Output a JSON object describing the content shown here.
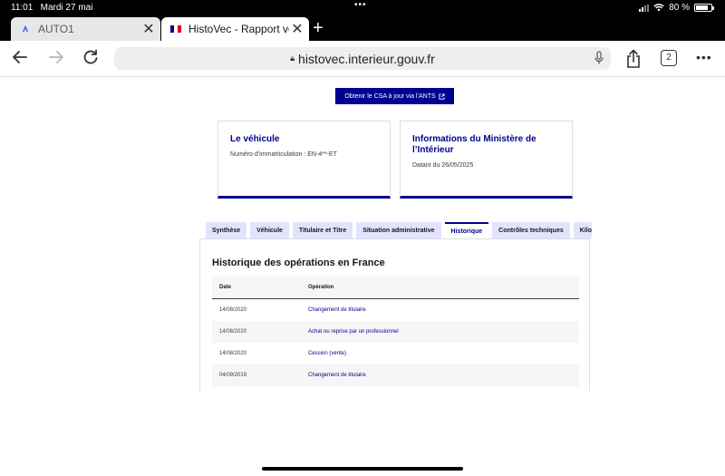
{
  "status": {
    "time": "11:01",
    "date": "Mardi 27 mai",
    "battery": "80 %",
    "battery_level": 0.8
  },
  "browser": {
    "tabs": [
      {
        "title": "AUTO1",
        "favicon": "auto1-logo-icon"
      },
      {
        "title": "HistoVec - Rapport vendeur",
        "favicon": "french-flag-icon"
      }
    ],
    "url": "histovec.interieur.gouv.fr",
    "tab_count": "2"
  },
  "page": {
    "cta_label": "Obtenir le CSA à jour via l’ANTS",
    "cards": [
      {
        "title": "Le véhicule",
        "desc": "Numéro d’immatriculation : EN-4**-ET"
      },
      {
        "title": "Informations du Ministère de l’Intérieur",
        "desc": "Datant du 26/05/2025"
      }
    ],
    "tabs": [
      "Synthèse",
      "Véhicule",
      "Titulaire et Titre",
      "Situation administrative",
      "Historique",
      "Contrôles techniques",
      "Kilométrage"
    ],
    "active_tab": "Historique",
    "history": {
      "heading": "Historique des opérations en France",
      "columns": [
        "Date",
        "Opération"
      ],
      "rows": [
        {
          "date": "14/08/2020",
          "operation": "Changement de titulaire"
        },
        {
          "date": "14/08/2020",
          "operation": "Achat ou reprise par un professionnel"
        },
        {
          "date": "14/08/2020",
          "operation": "Cession (vente)"
        },
        {
          "date": "04/09/2019",
          "operation": "Changement de titulaire"
        }
      ]
    }
  },
  "colors": {
    "primary": "#000091",
    "tab_bg": "#e3e3fd"
  }
}
